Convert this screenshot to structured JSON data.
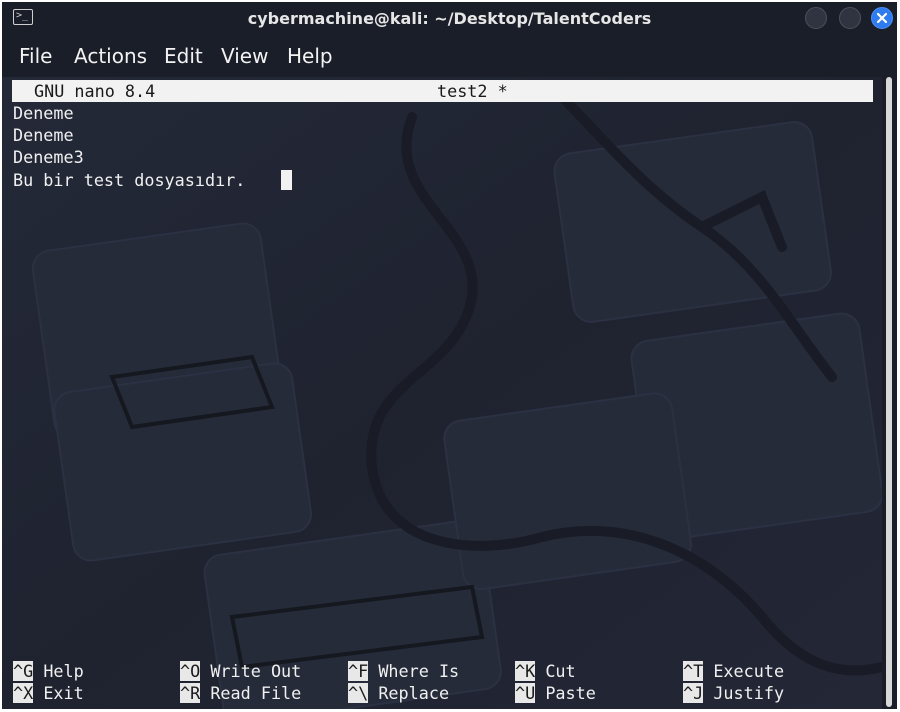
{
  "window": {
    "title": "cybermachine@kali: ~/Desktop/TalentCoders",
    "app_icon_glyph": ">_"
  },
  "menu": {
    "items": [
      "File",
      "Actions",
      "Edit",
      "View",
      "Help"
    ]
  },
  "nano": {
    "header_left": "GNU nano 8.4",
    "header_file": "test2 *",
    "lines": [
      "Deneme",
      "Deneme",
      "Deneme3",
      "Bu bir test dosyasıdır. "
    ],
    "shortcuts_row1": [
      {
        "key": "^G",
        "label": "Help"
      },
      {
        "key": "^O",
        "label": "Write Out"
      },
      {
        "key": "^F",
        "label": "Where Is"
      },
      {
        "key": "^K",
        "label": "Cut"
      },
      {
        "key": "^T",
        "label": "Execute"
      }
    ],
    "shortcuts_row2": [
      {
        "key": "^X",
        "label": "Exit"
      },
      {
        "key": "^R",
        "label": "Read File"
      },
      {
        "key": "^\\",
        "label": "Replace"
      },
      {
        "key": "^U",
        "label": "Paste"
      },
      {
        "key": "^J",
        "label": "Justify"
      }
    ]
  },
  "colors": {
    "terminal_bg": "#1f2330",
    "titlebar_bg": "#1a1e28",
    "close_button": "#2f7bf0",
    "header_bar": "#f2f2f2"
  }
}
